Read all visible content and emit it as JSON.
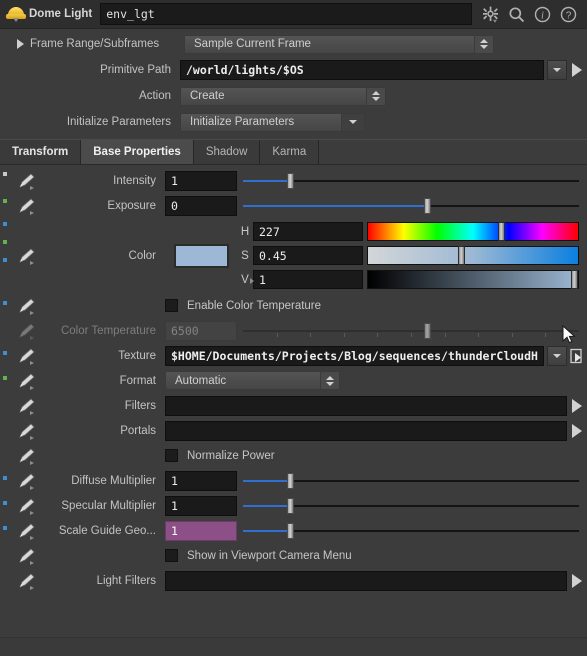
{
  "header": {
    "node_icon": "dome-light-icon",
    "node_type": "Dome Light",
    "node_name": "env_lgt",
    "icons": [
      {
        "name": "gear-icon",
        "label": "gear"
      },
      {
        "name": "search-icon",
        "label": "search"
      },
      {
        "name": "info-icon",
        "label": "info"
      },
      {
        "name": "help-icon",
        "label": "help"
      }
    ]
  },
  "top_params": {
    "frame_range": {
      "label": "Frame Range/Subframes",
      "value": "Sample Current Frame"
    },
    "primitive_path": {
      "label": "Primitive Path",
      "value": "/world/lights/$OS"
    },
    "action": {
      "label": "Action",
      "value": "Create"
    },
    "initialize": {
      "label": "Initialize Parameters",
      "value": "Initialize Parameters"
    }
  },
  "tabs": [
    {
      "label": "Transform",
      "active": false
    },
    {
      "label": "Base Properties",
      "active": true
    },
    {
      "label": "Shadow",
      "active": false
    },
    {
      "label": "Karma",
      "active": false
    }
  ],
  "base_properties": {
    "intensity": {
      "label": "Intensity",
      "value": "1",
      "slider_pct": 14
    },
    "exposure": {
      "label": "Exposure",
      "value": "0",
      "slider_pct": 55
    },
    "color": {
      "label": "Color",
      "swatch_hex": "#9cb8d4",
      "h": {
        "label": "H",
        "value": "227",
        "pct": 63
      },
      "s": {
        "label": "S",
        "value": "0.45",
        "pct": 45
      },
      "v": {
        "label": "V",
        "value": "1",
        "pct": 100
      }
    },
    "enable_color_temperature": {
      "label": "Enable Color Temperature",
      "checked": false
    },
    "color_temperature": {
      "label": "Color Temperature",
      "value": "6500",
      "slider_pct": 55,
      "disabled": true
    },
    "texture": {
      "label": "Texture",
      "value": "$HOME/Documents/Projects/Blog/sequences/thunderCloudH"
    },
    "format": {
      "label": "Format",
      "value": "Automatic"
    },
    "filters": {
      "label": "Filters",
      "value": ""
    },
    "portals": {
      "label": "Portals",
      "value": ""
    },
    "normalize_power": {
      "label": "Normalize Power",
      "checked": false
    },
    "diffuse_multiplier": {
      "label": "Diffuse Multiplier",
      "value": "1",
      "slider_pct": 14
    },
    "specular_multiplier": {
      "label": "Specular Multiplier",
      "value": "1",
      "slider_pct": 14
    },
    "scale_guide_geo": {
      "label": "Scale Guide Geo...",
      "value": "1",
      "slider_pct": 14,
      "animated": true
    },
    "show_in_viewport_camera_menu": {
      "label": "Show in Viewport Camera Menu",
      "checked": false
    },
    "light_filters": {
      "label": "Light Filters",
      "value": ""
    }
  },
  "colors": {
    "accent_blue": "#2f6fd0",
    "animated_purple": "#8d4f87",
    "panel_bg": "#3c3c3c",
    "field_bg": "#1a1a1a"
  }
}
